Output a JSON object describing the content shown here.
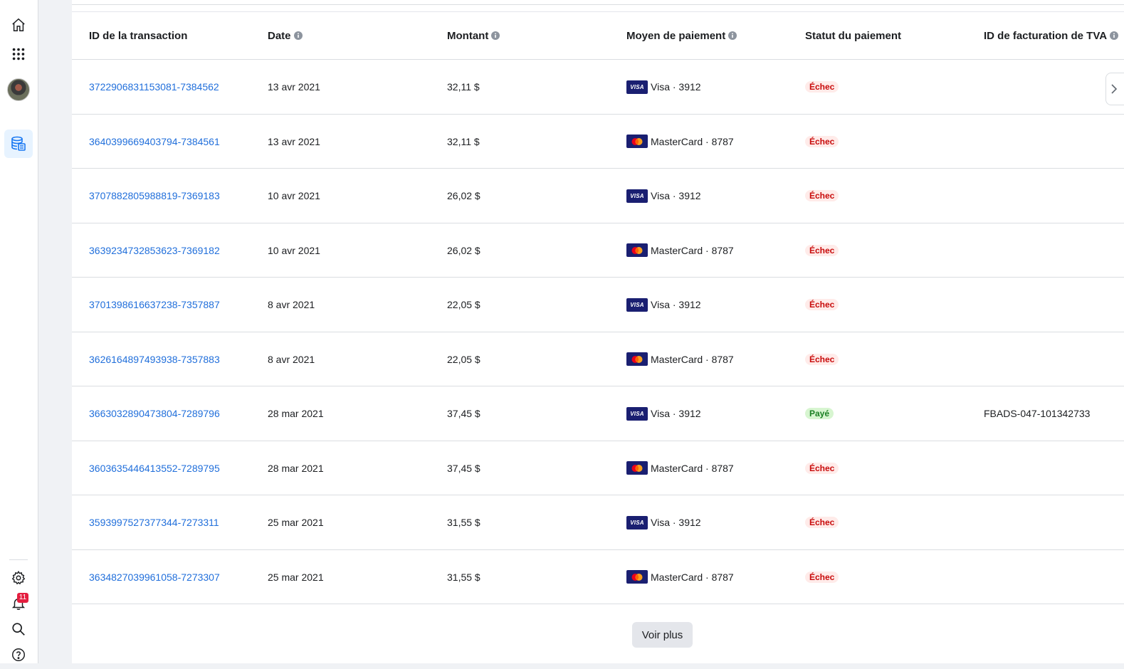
{
  "rail": {
    "top_icons": [
      "home-icon",
      "apps-grid-icon",
      "avatar",
      "billing-icon"
    ],
    "bottom_icons": [
      "settings-icon",
      "notifications-icon",
      "search-icon",
      "help-icon"
    ],
    "notifications_count": "11"
  },
  "table": {
    "headers": {
      "transaction_id": "ID de la transaction",
      "date": "Date",
      "amount": "Montant",
      "payment_method": "Moyen de paiement",
      "payment_status": "Statut du paiement",
      "vat_billing_id": "ID de facturation de TVA"
    },
    "rows": [
      {
        "id": "3722906831153081-7384562",
        "date": "13 avr 2021",
        "amount": "32,11 $",
        "card": "visa",
        "card_text": "Visa · 3912",
        "status": "Échec",
        "status_kind": "fail",
        "vat": ""
      },
      {
        "id": "3640399669403794-7384561",
        "date": "13 avr 2021",
        "amount": "32,11 $",
        "card": "mastercard",
        "card_text": "MasterCard · 8787",
        "status": "Échec",
        "status_kind": "fail",
        "vat": ""
      },
      {
        "id": "3707882805988819-7369183",
        "date": "10 avr 2021",
        "amount": "26,02 $",
        "card": "visa",
        "card_text": "Visa · 3912",
        "status": "Échec",
        "status_kind": "fail",
        "vat": ""
      },
      {
        "id": "3639234732853623-7369182",
        "date": "10 avr 2021",
        "amount": "26,02 $",
        "card": "mastercard",
        "card_text": "MasterCard · 8787",
        "status": "Échec",
        "status_kind": "fail",
        "vat": ""
      },
      {
        "id": "3701398616637238-7357887",
        "date": "8 avr 2021",
        "amount": "22,05 $",
        "card": "visa",
        "card_text": "Visa · 3912",
        "status": "Échec",
        "status_kind": "fail",
        "vat": ""
      },
      {
        "id": "3626164897493938-7357883",
        "date": "8 avr 2021",
        "amount": "22,05 $",
        "card": "mastercard",
        "card_text": "MasterCard · 8787",
        "status": "Échec",
        "status_kind": "fail",
        "vat": ""
      },
      {
        "id": "3663032890473804-7289796",
        "date": "28 mar 2021",
        "amount": "37,45 $",
        "card": "visa",
        "card_text": "Visa · 3912",
        "status": "Payé",
        "status_kind": "ok",
        "vat": "FBADS-047-101342733"
      },
      {
        "id": "3603635446413552-7289795",
        "date": "28 mar 2021",
        "amount": "37,45 $",
        "card": "mastercard",
        "card_text": "MasterCard · 8787",
        "status": "Échec",
        "status_kind": "fail",
        "vat": ""
      },
      {
        "id": "3593997527377344-7273311",
        "date": "25 mar 2021",
        "amount": "31,55 $",
        "card": "visa",
        "card_text": "Visa · 3912",
        "status": "Échec",
        "status_kind": "fail",
        "vat": ""
      },
      {
        "id": "3634827039961058-7273307",
        "date": "25 mar 2021",
        "amount": "31,55 $",
        "card": "mastercard",
        "card_text": "MasterCard · 8787",
        "status": "Échec",
        "status_kind": "fail",
        "vat": ""
      }
    ],
    "visa_logo_text": "VISA"
  },
  "footer": {
    "see_more_label": "Voir plus"
  },
  "colors": {
    "link": "#216fdb",
    "fail_bg": "#ffebe9",
    "fail_text": "#c80b0b",
    "ok_bg": "#d7f5d0",
    "ok_text": "#1a7f23",
    "card_bg": "#1a1f71"
  }
}
